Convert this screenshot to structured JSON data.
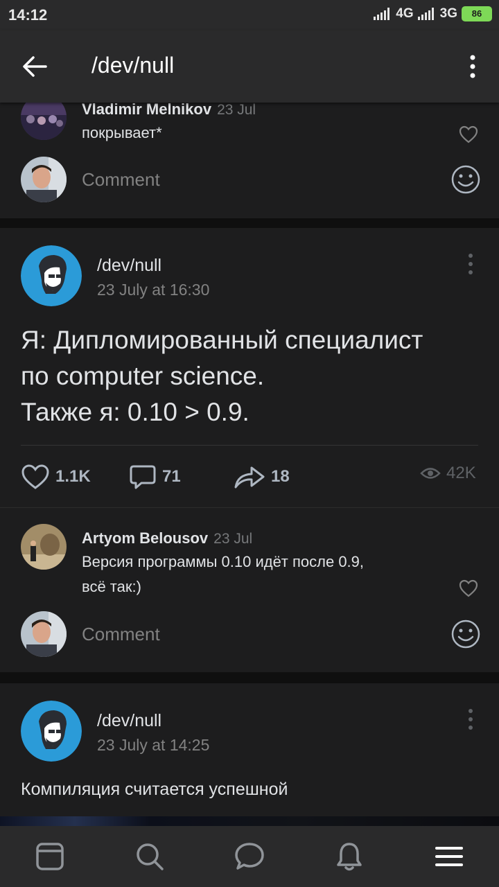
{
  "status": {
    "time": "14:12",
    "net1": "4G",
    "net2": "3G",
    "battery": "86"
  },
  "appbar": {
    "title": "/dev/null"
  },
  "top_comment": {
    "author": "Vladimir Melnikov",
    "date": "23 Jul",
    "text": "покрывает*"
  },
  "comment_placeholder": "Comment",
  "post1": {
    "author": "/dev/null",
    "date": "23 July at 16:30",
    "text_line1": "Я: Дипломированный специалист",
    "text_line2": "по computer science.",
    "text_line3": "Также я: 0.10 > 0.9.",
    "likes": "1.1K",
    "comments": "71",
    "shares": "18",
    "views": "42K",
    "comment": {
      "author": "Artyom Belousov",
      "date": "23 Jul",
      "text_line1": "Версия программы 0.10 идёт после 0.9,",
      "text_line2": "всё так:)"
    }
  },
  "post2": {
    "author": "/dev/null",
    "date": "23 July at 14:25",
    "text": "Компиляция считается успешной"
  },
  "icons": {
    "back": "arrow-left-icon",
    "more": "more-vertical-icon",
    "like": "heart-icon",
    "comment": "speech-bubble-icon",
    "share": "share-arrow-icon",
    "views": "eye-icon",
    "smile": "smile-icon"
  },
  "bottom_nav": [
    "news-icon",
    "search-icon",
    "messages-icon",
    "notifications-icon",
    "menu-icon"
  ],
  "colors": {
    "background": "#0f0f0f",
    "card": "#1d1d1e",
    "bar": "#2a2a2b",
    "avatar_blue": "#2b9bd8",
    "text": "#e1e3e6",
    "muted": "#828282"
  }
}
